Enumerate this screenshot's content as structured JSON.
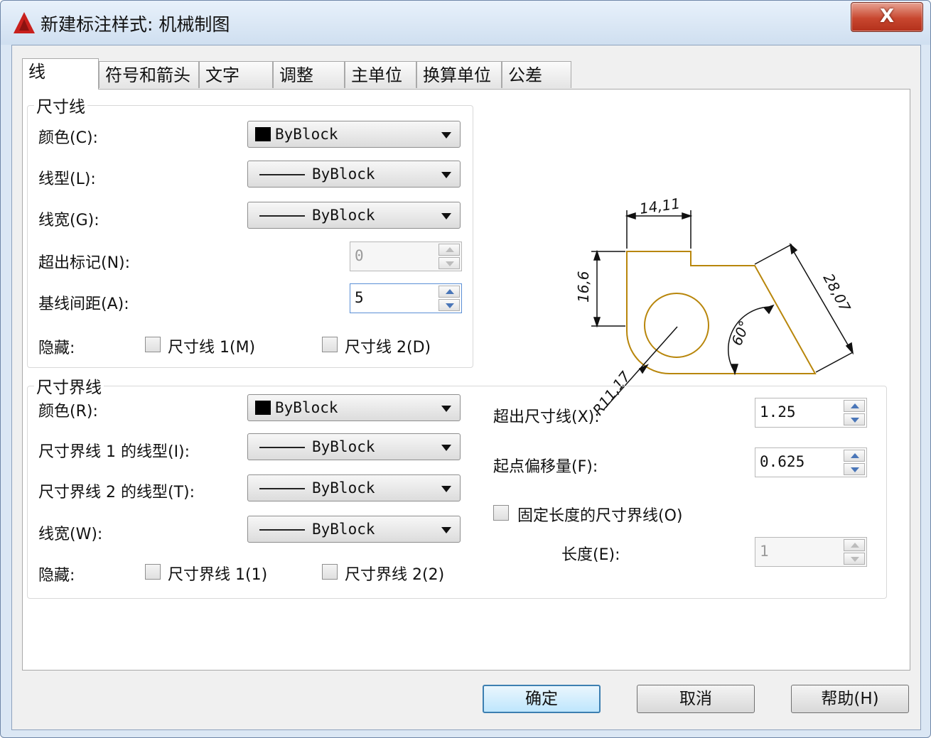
{
  "window": {
    "title": "新建标注样式: 机械制图",
    "close_label": "X"
  },
  "tabs": [
    "线",
    "符号和箭头",
    "文字",
    "调整",
    "主单位",
    "换算单位",
    "公差"
  ],
  "dim_lines": {
    "title": "尺寸线",
    "color_label": "颜色(C):",
    "color_value": "ByBlock",
    "linetype_label": "线型(L):",
    "linetype_value": "ByBlock",
    "lineweight_label": "线宽(G):",
    "lineweight_value": "ByBlock",
    "extend_ticks_label": "超出标记(N):",
    "extend_ticks_value": "0",
    "baseline_spacing_label": "基线间距(A):",
    "baseline_spacing_value": "5",
    "suppress_label": "隐藏:",
    "suppress_1": "尺寸线 1(M)",
    "suppress_2": "尺寸线 2(D)"
  },
  "ext_lines": {
    "title": "尺寸界线",
    "color_label": "颜色(R):",
    "color_value": "ByBlock",
    "linetype1_label": "尺寸界线 1 的线型(I):",
    "linetype1_value": "ByBlock",
    "linetype2_label": "尺寸界线 2 的线型(T):",
    "linetype2_value": "ByBlock",
    "lineweight_label": "线宽(W):",
    "lineweight_value": "ByBlock",
    "suppress_label": "隐藏:",
    "suppress_1": "尺寸界线 1(1)",
    "suppress_2": "尺寸界线 2(2)",
    "extend_beyond_label": "超出尺寸线(X):",
    "extend_beyond_value": "1.25",
    "offset_label": "起点偏移量(F):",
    "offset_value": "0.625",
    "fixed_length_label": "固定长度的尺寸界线(O)",
    "length_label": "长度(E):",
    "length_value": "1"
  },
  "preview": {
    "dim_top": "14,11",
    "dim_left": "16,6",
    "dim_slant": "28,07",
    "dim_angle": "60°",
    "dim_radius": "R11,17",
    "shape_color": "#b8860b"
  },
  "buttons": {
    "ok": "确定",
    "cancel": "取消",
    "help": "帮助(H)"
  }
}
